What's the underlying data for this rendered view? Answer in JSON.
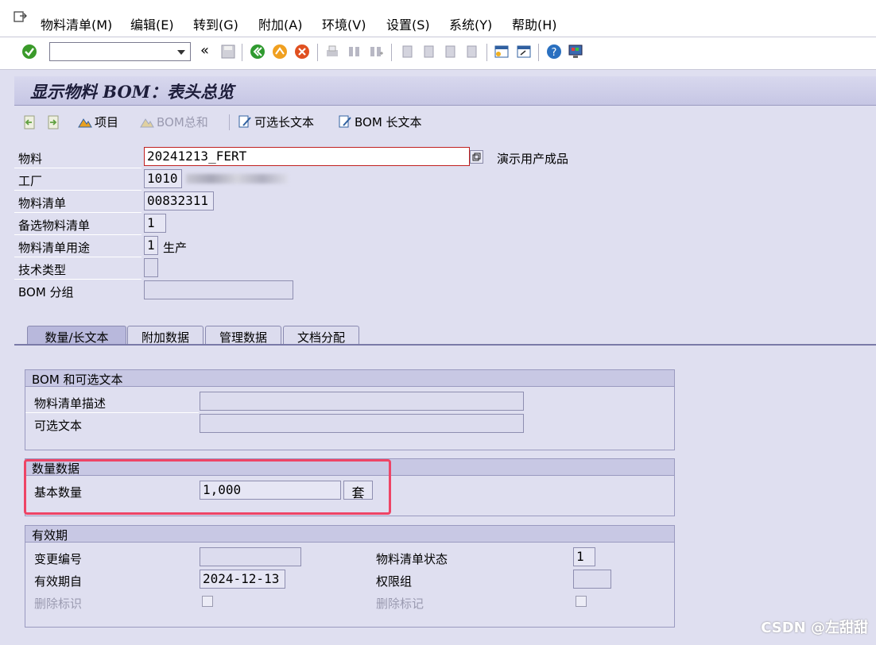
{
  "menu": {
    "items": [
      "物料清单(M)",
      "编辑(E)",
      "转到(G)",
      "附加(A)",
      "环境(V)",
      "设置(S)",
      "系统(Y)",
      "帮助(H)"
    ]
  },
  "toolbar": {
    "command_value": "",
    "icons": [
      "enter-check-icon",
      "back-arrows-icon",
      "save-icon",
      "back-icon",
      "exit-icon",
      "cancel-icon",
      "print-icon",
      "find-icon",
      "find-next-icon",
      "first-page-icon",
      "prev-page-icon",
      "next-page-icon",
      "last-page-icon",
      "new-session-icon",
      "shortcut-icon",
      "help-icon",
      "customize-layout-icon"
    ]
  },
  "title": "显示物料 BOM：表头总览",
  "app_toolbar": {
    "items_label": "项目",
    "bom_sum_label": "BOM总和",
    "alt_longtext_label": "可选长文本",
    "bom_longtext_label": "BOM 长文本"
  },
  "header": {
    "material_label": "物料",
    "material_value": "20241213_FERT",
    "material_desc": "演示用产成品",
    "plant_label": "工厂",
    "plant_value": "1010",
    "bom_label": "物料清单",
    "bom_value": "00832311",
    "alt_bom_label": "备选物料清单",
    "alt_bom_value": "1",
    "usage_label": "物料清单用途",
    "usage_value": "1",
    "usage_desc": "生产",
    "tech_type_label": "技术类型",
    "tech_type_value": "",
    "bom_group_label": "BOM 分组",
    "bom_group_value": ""
  },
  "tabs": [
    "数量/长文本",
    "附加数据",
    "管理数据",
    "文档分配"
  ],
  "group_text": {
    "title": "BOM 和可选文本",
    "desc_label": "物料清单描述",
    "desc_value": "",
    "alt_text_label": "可选文本",
    "alt_text_value": ""
  },
  "group_qty": {
    "title": "数量数据",
    "base_qty_label": "基本数量",
    "base_qty_value": "1,000",
    "unit_value": "套"
  },
  "group_valid": {
    "title": "有效期",
    "change_no_label": "变更编号",
    "change_no_value": "",
    "valid_from_label": "有效期自",
    "valid_from_value": "2024-12-13",
    "delete_flag_label": "删除标识",
    "bom_status_label": "物料清单状态",
    "bom_status_value": "1",
    "auth_group_label": "权限组",
    "auth_group_value": "",
    "delete_mark_label": "删除标记"
  },
  "watermark": "CSDN @左甜甜"
}
